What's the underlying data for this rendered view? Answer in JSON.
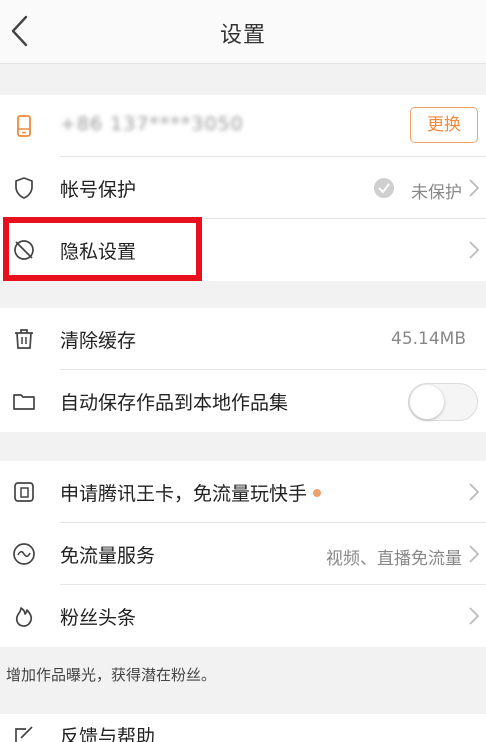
{
  "header": {
    "title": "设置"
  },
  "account": {
    "phone": "+86 137****3050",
    "change_label": "更换",
    "protect_label": "帐号保护",
    "protect_status": "未保护",
    "privacy_label": "隐私设置"
  },
  "storage": {
    "clear_cache_label": "清除缓存",
    "cache_size": "45.14MB",
    "auto_save_label": "自动保存作品到本地作品集",
    "auto_save_enabled": false
  },
  "services": {
    "wangka_label": "申请腾讯王卡，免流量玩快手",
    "free_flow_label": "免流量服务",
    "free_flow_value": "视频、直播免流量",
    "fans_label": "粉丝头条",
    "note": "增加作品曝光，获得潜在粉丝。"
  },
  "feedback": {
    "label": "反馈与帮助"
  },
  "colors": {
    "accent": "#f08a3c",
    "highlight": "#e8101c"
  }
}
